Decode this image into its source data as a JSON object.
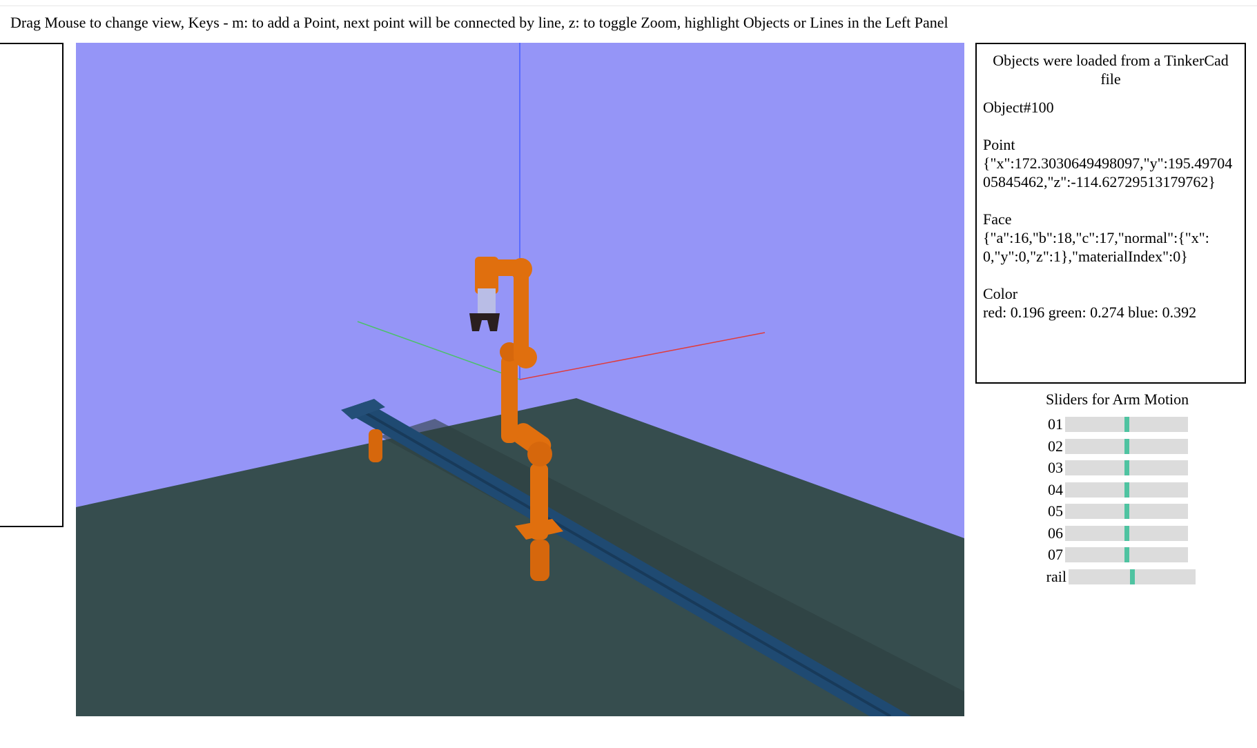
{
  "instructions": "Drag Mouse to change view, Keys - m: to add a Point, next point will be connected by line, z: to toggle Zoom, highlight Objects or Lines in the Left Panel",
  "info_panel": {
    "title": "Objects were loaded from a TinkerCad file",
    "object": "Object#100",
    "point_label": "Point",
    "point_value": "{\"x\":172.3030649498097,\"y\":195.4970405845462,\"z\":-114.62729513179762}",
    "face_label": "Face",
    "face_value": "{\"a\":16,\"b\":18,\"c\":17,\"normal\":{\"x\":0,\"y\":0,\"z\":1},\"materialIndex\":0}",
    "color_label": "Color",
    "color_value": "red: 0.196 green: 0.274 blue: 0.392"
  },
  "sliders": {
    "title": "Sliders for Arm Motion",
    "items": [
      {
        "label": "01",
        "value": 0.5
      },
      {
        "label": "02",
        "value": 0.5
      },
      {
        "label": "03",
        "value": 0.5
      },
      {
        "label": "04",
        "value": 0.5
      },
      {
        "label": "05",
        "value": 0.5
      },
      {
        "label": "06",
        "value": 0.5
      },
      {
        "label": "07",
        "value": 0.5
      },
      {
        "label": "rail",
        "value": 0.5
      }
    ]
  },
  "colors": {
    "sky": "#9595f7",
    "floor": "#2f4a4a",
    "arm": "#e06f0e",
    "rail": "#244a70",
    "slider_thumb": "#4fc3a1"
  }
}
